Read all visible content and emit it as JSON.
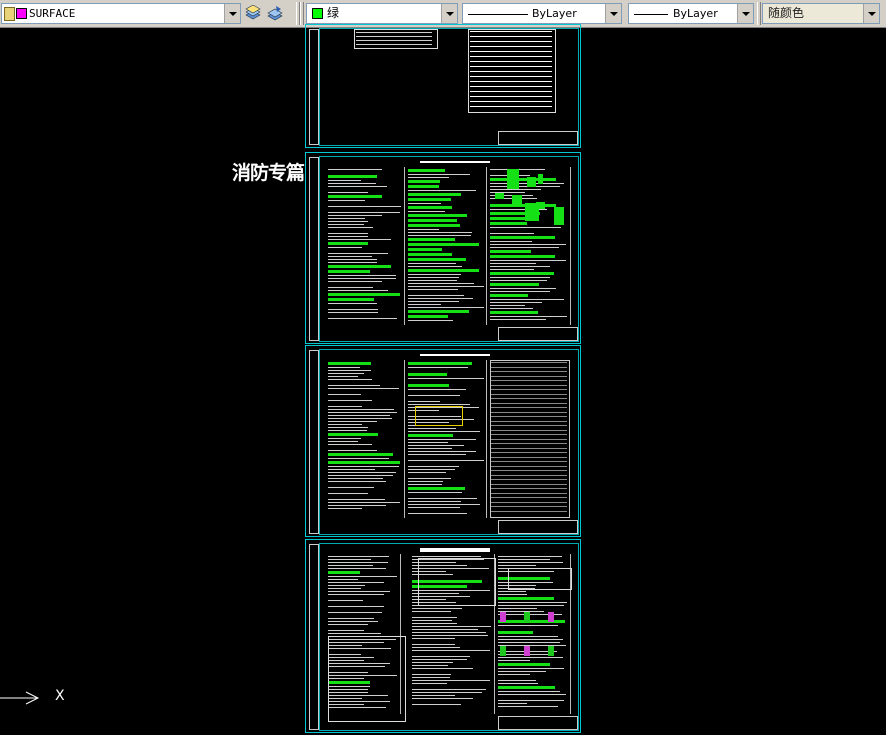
{
  "toolbar": {
    "layer": {
      "name": "SURFACE",
      "color": "#ff00ff"
    },
    "color_control": {
      "label": "绿",
      "color": "#00ff00"
    },
    "linetype_control": {
      "label": "ByLayer"
    },
    "lineweight_control": {
      "label": "ByLayer"
    },
    "plotstyle_control": {
      "label": "随颜色"
    },
    "icons": [
      "layer-state-icon",
      "layer-previous-icon",
      "layer-properties-icon"
    ]
  },
  "canvas": {
    "background": "#000000",
    "frame_color": "#00c8d2",
    "section_label": "消防专篇",
    "sheet_count": 4
  },
  "ucs": {
    "axis_label": "X"
  }
}
